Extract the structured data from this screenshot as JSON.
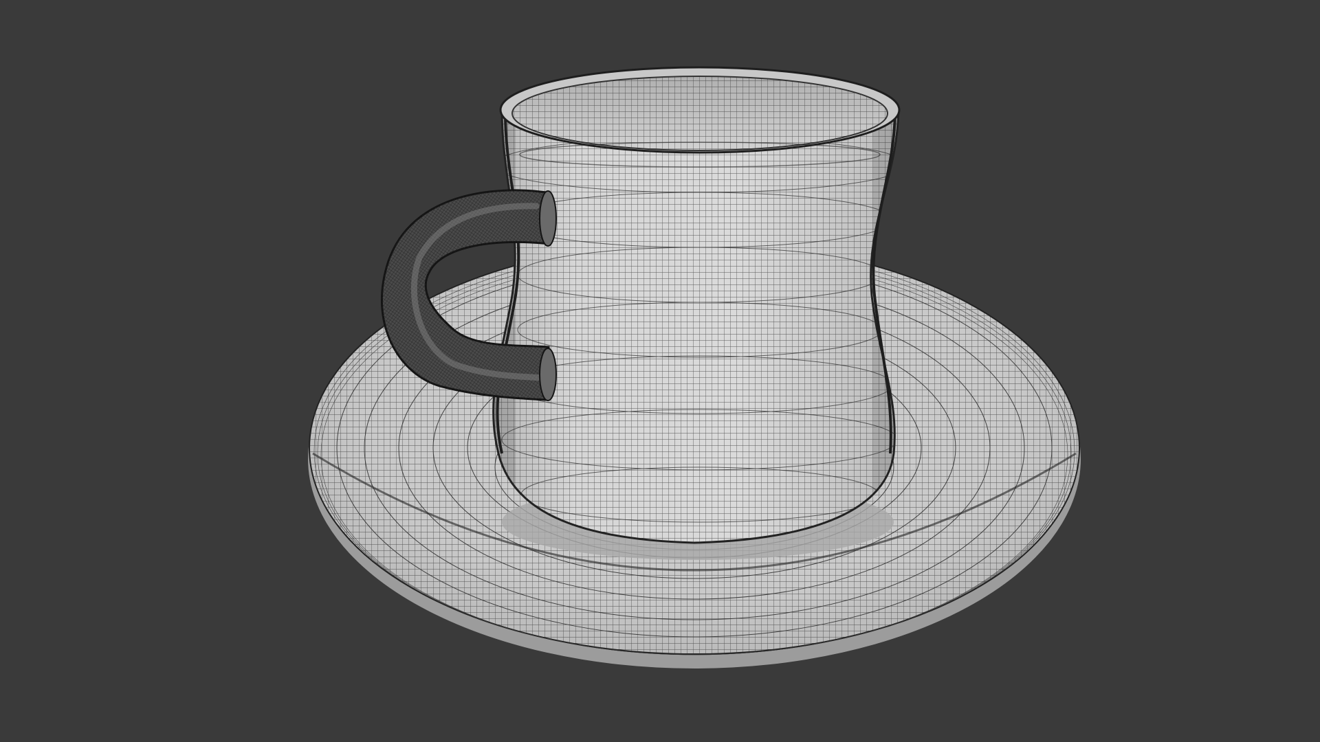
{
  "scene": {
    "background_color": "#3a3a3a",
    "surface_color": "#d4d4d4",
    "wire_color": "#2a2a2a",
    "display_mode": "wireframe-overlay",
    "objects": [
      {
        "name": "cup",
        "icon": "cup-mesh"
      },
      {
        "name": "handle",
        "icon": "handle-mesh"
      },
      {
        "name": "saucer",
        "icon": "saucer-mesh"
      }
    ]
  }
}
